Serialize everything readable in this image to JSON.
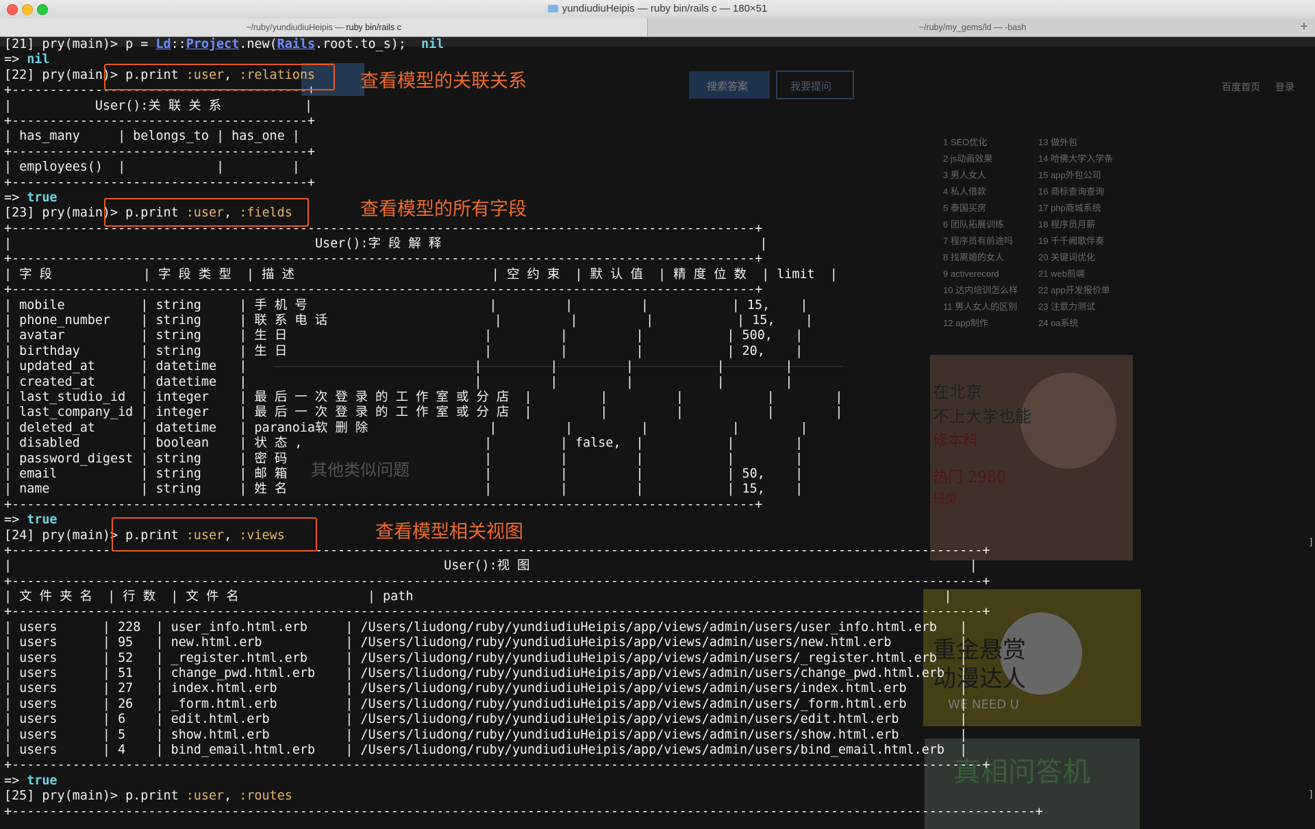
{
  "window": {
    "title": "yundiudiuHeipis — ruby bin/rails c — 180×51",
    "tabs": [
      {
        "path": "~/ruby/yundiudiuHeipis — ",
        "cmd": "ruby bin/rails c"
      },
      {
        "path": "~/ruby/my_gems/ld — ",
        "cmd": "-bash"
      }
    ],
    "add_tab": "+"
  },
  "annotations": {
    "relations": "查看模型的关联关系",
    "fields": "查看模型的所有字段",
    "views": "查看模型相关视图"
  },
  "terminal_lines": [
    "[21] pry(main)> p = Ld::Project.new(Rails.root.to_s);  nil",
    "=> nil",
    "[22] pry(main)> p.print :user, :relations",
    "+---------------------------------------+",
    "|           User():关 联 关 系           |",
    "+---------------------------------------+",
    "| has_many     | belongs_to | has_one |",
    "+---------------------------------------+",
    "| employees()  |            |         |",
    "+---------------------------------------+",
    "=> true",
    "[23] pry(main)> p.print :user, :fields",
    "+--------------------------------------------------------------------------------------------------+",
    "|                                        User():字 段 解 释                                          |",
    "+--------------------------------------------------------------------------------------------------+",
    "| 字 段            | 字 段 类 型  | 描 述                          | 空 约 束  | 默 认 值  | 精 度 位 数  | limit  |",
    "+--------------------------------------------------------------------------------------------------+",
    "| mobile          | string     | 手 机 号                        |         |         |           | 15,    |",
    "| phone_number    | string     | 联 系 电 话                      |         |         |           | 15,    |",
    "| avatar          | string     | 生 日                          |         |         |           | 500,   |",
    "| birthday        | string     | 生 日                          |         |         |           | 20,    |",
    "| updated_at      | datetime   |                              |         |         |           |        |",
    "| created_at      | datetime   |                              |         |         |           |        |",
    "| last_studio_id  | integer    | 最 后 一 次 登 录 的 工 作 室 或 分 店  |         |         |           |        |",
    "| last_company_id | integer    | 最 后 一 次 登 录 的 工 作 室 或 分 店  |         |         |           |        |",
    "| deleted_at      | datetime   | paranoia软 删 除                |         |         |           |        |",
    "| disabled        | boolean    | 状 态 ,                        |         | false,  |           |        |",
    "| password_digest | string     | 密 码                          |         |         |           |        |",
    "| email           | string     | 邮 箱                          |         |         |           | 50,    |",
    "| name            | string     | 姓 名                          |         |         |           | 15,    |",
    "+--------------------------------------------------------------------------------------------------+",
    "=> true",
    "[24] pry(main)> p.print :user, :views",
    "+--------------------------------------------------------------------------------------------------------------------------------+",
    "|                                                         User():视 图                                                          |",
    "+--------------------------------------------------------------------------------------------------------------------------------+",
    "| 文 件 夹 名  | 行 数  | 文 件 名                 | path                                                                      |",
    "+--------------------------------------------------------------------------------------------------------------------------------+",
    "| users      | 228  | user_info.html.erb     | /Users/liudong/ruby/yundiudiuHeipis/app/views/admin/users/user_info.html.erb   |",
    "| users      | 95   | new.html.erb           | /Users/liudong/ruby/yundiudiuHeipis/app/views/admin/users/new.html.erb         |",
    "| users      | 52   | _register.html.erb     | /Users/liudong/ruby/yundiudiuHeipis/app/views/admin/users/_register.html.erb   |",
    "| users      | 51   | change_pwd.html.erb    | /Users/liudong/ruby/yundiudiuHeipis/app/views/admin/users/change_pwd.html.erb  |",
    "| users      | 27   | index.html.erb         | /Users/liudong/ruby/yundiudiuHeipis/app/views/admin/users/index.html.erb       |",
    "| users      | 26   | _form.html.erb         | /Users/liudong/ruby/yundiudiuHeipis/app/views/admin/users/_form.html.erb       |",
    "| users      | 6    | edit.html.erb          | /Users/liudong/ruby/yundiudiuHeipis/app/views/admin/users/edit.html.erb        |",
    "| users      | 5    | show.html.erb          | /Users/liudong/ruby/yundiudiuHeipis/app/views/admin/users/show.html.erb        |",
    "| users      | 4    | bind_email.html.erb    | /Users/liudong/ruby/yundiudiuHeipis/app/views/admin/users/bind_email.html.erb  |",
    "+--------------------------------------------------------------------------------------------------------------------------------+",
    "=> true",
    "[25] pry(main)> p.print :user, :routes",
    "+---------------------------------------------------------------------------------------------------------------------------------------+"
  ],
  "background_page": {
    "nav": [
      "百度首页",
      "登录"
    ],
    "search_buttons": [
      "搜索答案",
      "我要提问"
    ],
    "hot_list": [
      "1 SEO优化",
      "2 js动画效果",
      "3 男人女人",
      "4 私人借款",
      "5 泰国买房",
      "6 团队拓展训练",
      "7 程序员有前途吗",
      "8 找离婚的女人",
      "9 activerecord",
      "10 达内培训怎么样",
      "11 男人女人的区别",
      "12 app制作",
      "13 做外包",
      "14 哈佛大学入学条",
      "15 app外包公司",
      "16 商标查询查询",
      "17 php商城系统",
      "18 程序员月薪",
      "19 千千阙歌伴奏",
      "20 关键词优化",
      "21 web前端",
      "22 app开发报价单",
      "23 注意力测试",
      "24 oa系统"
    ],
    "ad1": [
      "在北京",
      "不上大学也能",
      "修本科",
      "热门 2980",
      "班型"
    ],
    "ad2": [
      "重金悬赏",
      "动漫达人",
      "WE NEED U"
    ],
    "ad3": "真相问答机",
    "similar_title": "其他类似问题"
  },
  "colors": {
    "annotation": "#ec6a2a",
    "symbol": "#e5b567",
    "boolean": "#6bd4e6",
    "link_class": "#6c8cff"
  }
}
